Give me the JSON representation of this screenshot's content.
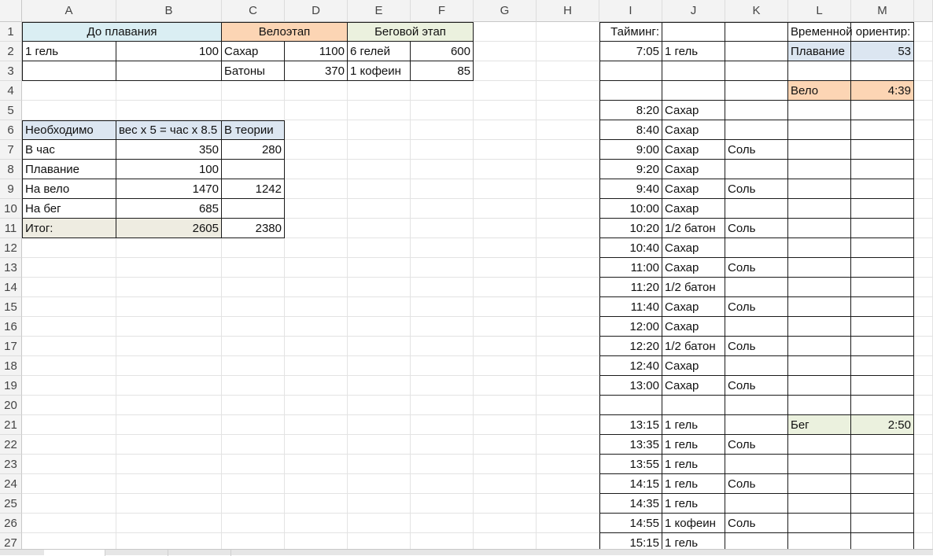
{
  "columns": [
    "A",
    "B",
    "C",
    "D",
    "E",
    "F",
    "G",
    "H",
    "I",
    "J",
    "K",
    "L",
    "M"
  ],
  "rows": [
    "1",
    "2",
    "3",
    "4",
    "5",
    "6",
    "7",
    "8",
    "9",
    "10",
    "11",
    "12",
    "13",
    "14",
    "15",
    "16",
    "17",
    "18",
    "19",
    "20",
    "21",
    "22",
    "23",
    "24",
    "25",
    "26",
    "27"
  ],
  "cells": {
    "A1": "До плавания",
    "C1": "Велоэтап",
    "E1": "Беговой этап",
    "A2": "1 гель",
    "B2": "100",
    "C2": "Сахар",
    "D2": "1100",
    "E2": "6 гелей",
    "F2": "600",
    "C3": "Батоны",
    "D3": "370",
    "E3": "1 кофеин",
    "F3": "85",
    "A6": "Необходимо",
    "B6": "вес x 5 = час x 8.5",
    "C6": "В теории",
    "A7": "В час",
    "B7": "350",
    "C7": "280",
    "A8": "Плавание",
    "B8": "100",
    "A9": "На вело",
    "B9": "1470",
    "C9": "1242",
    "A10": "На бег",
    "B10": "685",
    "A11": "Итог:",
    "B11": "2605",
    "C11": "2380",
    "I1": "Тайминг:",
    "I2": "7:05",
    "J2": "1 гель",
    "I5": "8:20",
    "J5": "Сахар",
    "I6": "8:40",
    "J6": "Сахар",
    "I7": "9:00",
    "J7": "Сахар",
    "K7": "Соль",
    "I8": "9:20",
    "J8": "Сахар",
    "I9": "9:40",
    "J9": "Сахар",
    "K9": "Соль",
    "I10": "10:00",
    "J10": "Сахар",
    "I11": "10:20",
    "J11": "1/2 батон",
    "K11": "Соль",
    "I12": "10:40",
    "J12": "Сахар",
    "I13": "11:00",
    "J13": "Сахар",
    "K13": "Соль",
    "I14": "11:20",
    "J14": "1/2 батон",
    "I15": "11:40",
    "J15": "Сахар",
    "K15": "Соль",
    "I16": "12:00",
    "J16": "Сахар",
    "I17": "12:20",
    "J17": "1/2 батон",
    "K17": "Соль",
    "I18": "12:40",
    "J18": "Сахар",
    "I19": "13:00",
    "J19": "Сахар",
    "K19": "Соль",
    "I21": "13:15",
    "J21": "1 гель",
    "I22": "13:35",
    "J22": "1 гель",
    "K22": "Соль",
    "I23": "13:55",
    "J23": "1 гель",
    "I24": "14:15",
    "J24": "1 гель",
    "K24": "Соль",
    "I25": "14:35",
    "J25": "1 гель",
    "I26": "14:55",
    "J26": "1 кофеин",
    "K26": "Соль",
    "I27": "15:15",
    "J27": "1 гель",
    "L1": "Временной ориентир:",
    "L2": "Плавание",
    "M2": "53",
    "L4": "Вело",
    "M4": "4:39",
    "L21": "Бег",
    "M21": "2:50"
  },
  "colors": {
    "swim_header": "#daeef3",
    "bike_header": "#fcd5b4",
    "run_header": "#ebf1de",
    "total_row": "#eeece1",
    "table_header": "#dce6f1"
  }
}
